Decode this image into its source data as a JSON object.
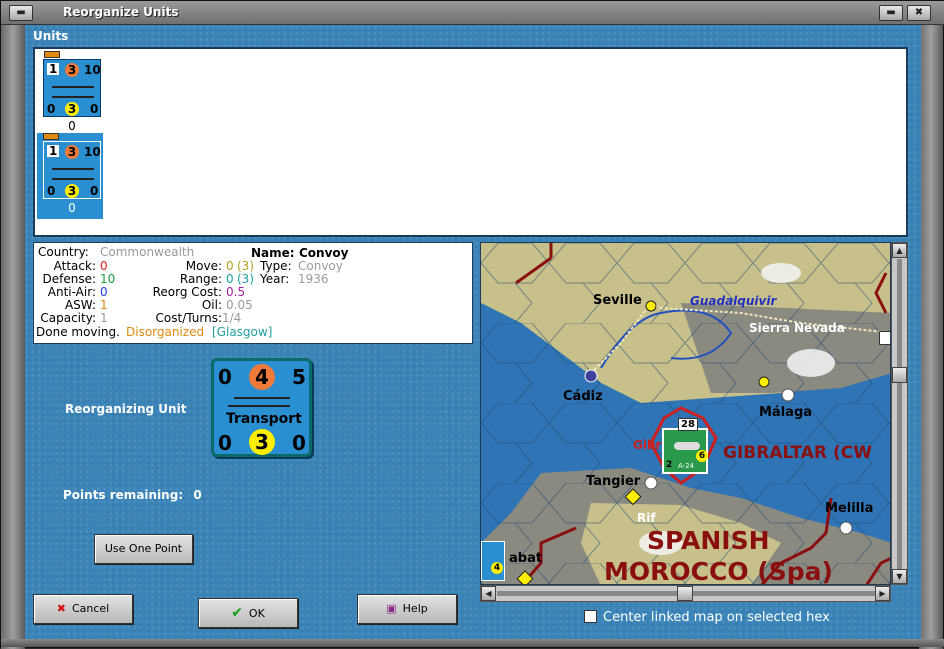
{
  "window": {
    "title": "Reorganize Units"
  },
  "units_section": {
    "label": "Units",
    "units": [
      {
        "top_left": "1",
        "top_mid": "3",
        "top_right": "10",
        "bottom_left": "0",
        "bottom_mid": "3",
        "bottom_right": "0",
        "count": "0",
        "selected": false
      },
      {
        "top_left": "1",
        "top_mid": "3",
        "top_right": "10",
        "bottom_left": "0",
        "bottom_mid": "3",
        "bottom_right": "0",
        "count": "0",
        "selected": true
      }
    ]
  },
  "info": {
    "country_label": "Country:",
    "country": "Commonwealth",
    "name_label": "Name:",
    "name": "Convoy",
    "attack_label": "Attack:",
    "attack": "0",
    "move_label": "Move:",
    "move": "0",
    "move_max": "(3)",
    "type_label": "Type:",
    "type": "Convoy",
    "defense_label": "Defense:",
    "defense": "10",
    "range_label": "Range:",
    "range": "0",
    "range_max": "(3)",
    "year_label": "Year:",
    "year": "1936",
    "antiair_label": "Anti-Air:",
    "antiair": "0",
    "reorg_label": "Reorg Cost:",
    "reorg": "0.5",
    "asw_label": "ASW:",
    "asw": "1",
    "oil_label": "Oil:",
    "oil": "0.05",
    "capacity_label": "Capacity:",
    "capacity": "1",
    "cost_label": "Cost/Turns:",
    "cost": "1/4",
    "status_text": "Done moving.",
    "status_disorg": "Disorganized",
    "status_loc": "[Glasgow]"
  },
  "reorganizing": {
    "label": "Reorganizing Unit",
    "counter": {
      "top_left": "0",
      "top_mid": "4",
      "top_right": "5",
      "name": "Transport",
      "bottom_left": "0",
      "bottom_mid": "3",
      "bottom_right": "0"
    }
  },
  "points": {
    "label": "Points remaining:",
    "value": "0"
  },
  "buttons": {
    "use_point": "Use One Point",
    "cancel": "Cancel",
    "ok": "OK",
    "help": "Help"
  },
  "map": {
    "labels": {
      "seville": "Seville",
      "guadalquivir": "Guadalquivir",
      "sierra": "Sierra Nevada",
      "cadiz": "Cádiz",
      "malaga": "Málaga",
      "gibraltar": "GIBRALTAR (CW",
      "gib_small": "Gibr",
      "tangier": "Tangier",
      "rif": "Rif",
      "melilla": "Melilla",
      "spanish": "SPANISH",
      "morocco": "MOROCCO (Spa)",
      "rabat": "abat",
      "unit_top": "28",
      "unit_bl": "2",
      "unit_br": "6",
      "unit_name": "A-24",
      "edge_unit_num": "4"
    },
    "center_checkbox_label": "Center linked map on selected hex",
    "center_checked": false
  },
  "colors": {
    "unit_blue": "#2a8fd0",
    "orange_circle": "#f07a3a",
    "yellow_circle": "#ffee00",
    "border_red": "#8a1010"
  }
}
